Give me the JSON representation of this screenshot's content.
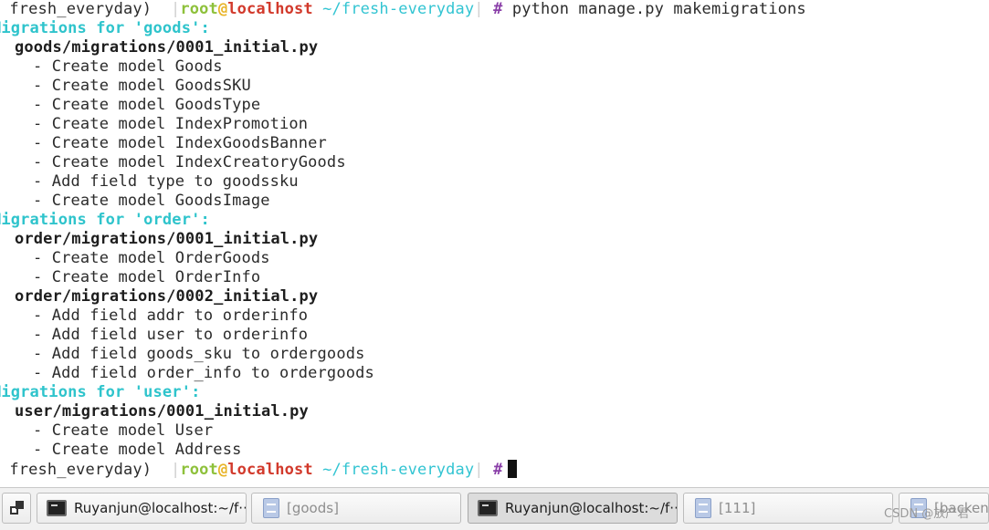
{
  "terminal": {
    "prompt": {
      "env": " fresh_everyday) ",
      "bar": "|",
      "user": "root",
      "at": "@",
      "host": "localhost",
      "path": "~/fresh-everyday",
      "symbol": "#"
    },
    "command": "python manage.py makemigrations",
    "goods_header": "Migrations for 'goods':",
    "goods_file": "goods/migrations/0001_initial.py",
    "goods_ops": [
      "- Create model Goods",
      "- Create model GoodsSKU",
      "- Create model GoodsType",
      "- Create model IndexPromotion",
      "- Create model IndexGoodsBanner",
      "- Create model IndexCreatoryGoods",
      "- Add field type to goodssku",
      "- Create model GoodsImage"
    ],
    "order_header": "Migrations for 'order':",
    "order_file1": "order/migrations/0001_initial.py",
    "order_ops1": [
      "- Create model OrderGoods",
      "- Create model OrderInfo"
    ],
    "order_file2": "order/migrations/0002_initial.py",
    "order_ops2": [
      "- Add field addr to orderinfo",
      "- Add field user to orderinfo",
      "- Add field goods_sku to ordergoods",
      "- Add field order_info to ordergoods"
    ],
    "user_header": "Migrations for 'user':",
    "user_file": "user/migrations/0001_initial.py",
    "user_ops": [
      "- Create model User",
      "- Create model Address"
    ]
  },
  "taskbar": {
    "tasks": [
      {
        "label": "Ruyanjun@localhost:~/f···",
        "icon": "terminal-icon"
      },
      {
        "label": "[goods]",
        "icon": "file-manager-icon"
      },
      {
        "label": "Ruyanjun@localhost:~/f···",
        "icon": "terminal-icon"
      },
      {
        "label": "[111]",
        "icon": "file-manager-icon"
      },
      {
        "label": "[backend",
        "icon": "file-manager-icon"
      }
    ]
  },
  "watermark": "CSDN @放产君"
}
